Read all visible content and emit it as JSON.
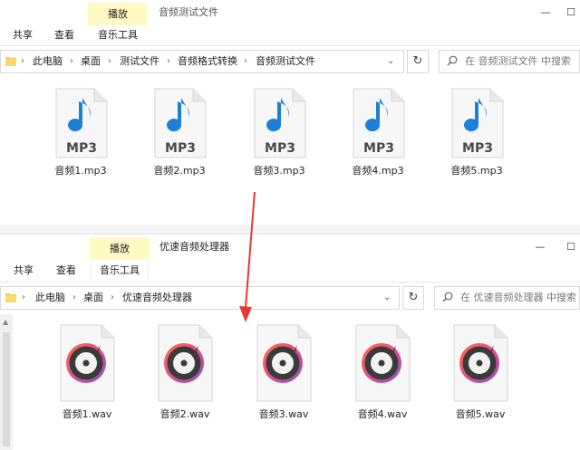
{
  "windows": [
    {
      "manage_tab": "播放",
      "title": "音频测试文件",
      "ribbon_tabs": [
        "共享",
        "查看",
        "音乐工具"
      ],
      "breadcrumb": [
        "此电脑",
        "桌面",
        "测试文件",
        "音频格式转换",
        "音频测试文件"
      ],
      "search_placeholder": "在 音频测试文件 中搜索",
      "files": [
        "音频1.mp3",
        "音频2.mp3",
        "音频3.mp3",
        "音频4.mp3",
        "音频5.mp3"
      ],
      "icon_type": "mp3-file-icon",
      "icon_label": "MP3"
    },
    {
      "manage_tab": "播放",
      "title": "优速音频处理器",
      "ribbon_tabs": [
        "共享",
        "查看",
        "音乐工具"
      ],
      "breadcrumb": [
        "此电脑",
        "桌面",
        "优速音频处理器"
      ],
      "search_placeholder": "在 优速音频处理器 中搜索",
      "files": [
        "音频1.wav",
        "音频2.wav",
        "音频3.wav",
        "音频4.wav",
        "音频5.wav"
      ],
      "icon_type": "wav-file-icon"
    }
  ],
  "window_buttons": {
    "minimize": "—",
    "maximize": "☐"
  },
  "colors": {
    "manage_tab_bg": "#fff9c4",
    "mp3_note": "#1e7fd8",
    "arrow": "#e53935",
    "disc_ring_start": "#ff7043",
    "disc_ring_end": "#7e57c2"
  }
}
